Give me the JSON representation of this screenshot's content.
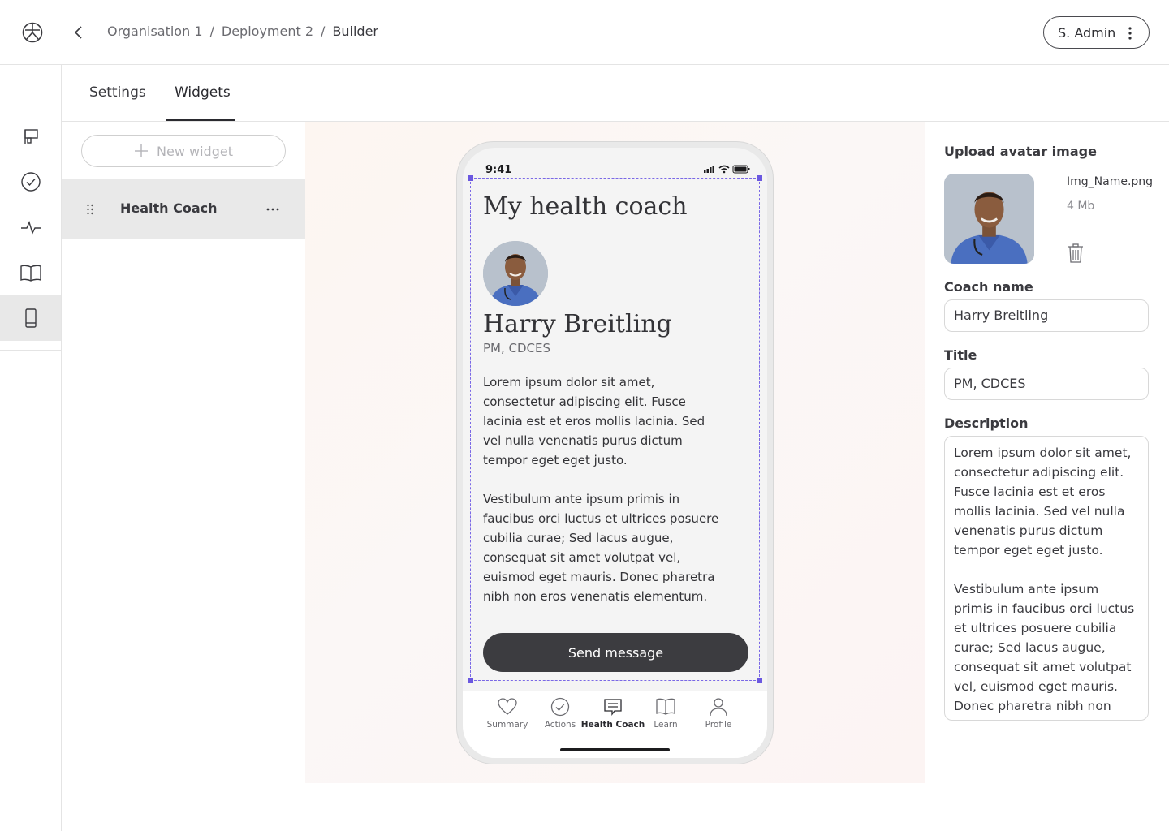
{
  "header": {
    "breadcrumb": [
      "Organisation 1",
      "Deployment 2",
      "Builder"
    ],
    "separator": "/",
    "user_label": "S. Admin"
  },
  "rail": {
    "items": [
      {
        "icon": "flag-board-icon"
      },
      {
        "icon": "check-circle-icon"
      },
      {
        "icon": "pulse-icon"
      },
      {
        "icon": "book-icon"
      },
      {
        "icon": "mobile-phone-icon",
        "active": true
      }
    ]
  },
  "tabs": [
    {
      "label": "Settings"
    },
    {
      "label": "Widgets",
      "active": true
    }
  ],
  "widgets": {
    "new_label": "New widget",
    "items": [
      {
        "label": "Health Coach"
      }
    ]
  },
  "phone": {
    "time": "9:41",
    "heading": "My health coach",
    "coach_name": "Harry Breitling",
    "coach_title": "PM, CDCES",
    "description": "Lorem ipsum dolor sit amet, consectetur adipiscing elit. Fusce lacinia est et eros mollis lacinia. Sed vel nulla venenatis purus dictum tempor eget eget justo.\n\nVestibulum ante ipsum primis in faucibus orci luctus et ultrices posuere cubilia curae; Sed lacus augue, consequat sit amet volutpat vel, euismod eget mauris. Donec pharetra nibh non eros venenatis elementum.",
    "button": "Send message",
    "nav": [
      {
        "label": "Summary",
        "icon": "heart-icon"
      },
      {
        "label": "Actions",
        "icon": "check-circle-icon"
      },
      {
        "label": "Health Coach",
        "icon": "chat-icon",
        "active": true
      },
      {
        "label": "Learn",
        "icon": "book-icon"
      },
      {
        "label": "Profile",
        "icon": "person-icon"
      }
    ]
  },
  "props": {
    "upload_label": "Upload avatar image",
    "file_name": "Img_Name.png",
    "file_size": "4 Mb",
    "coach_name_label": "Coach name",
    "coach_name_value": "Harry Breitling",
    "title_label": "Title",
    "title_value": "PM, CDCES",
    "description_label": "Description",
    "description_value": "Lorem ipsum dolor sit amet, consectetur adipiscing elit. Fusce lacinia est et eros mollis lacinia. Sed vel nulla venenatis purus dictum tempor eget eget justo.\n\nVestibulum ante ipsum primis in faucibus orci luctus et ultrices posuere cubilia curae; Sed lacus augue, consequat sit amet volutpat vel, euismod eget mauris. Donec pharetra nibh non eros venenatis elementum."
  },
  "colors": {
    "selection": "#7a68e6",
    "button": "#3c3c40",
    "active_rail": "#e8e8e8"
  }
}
